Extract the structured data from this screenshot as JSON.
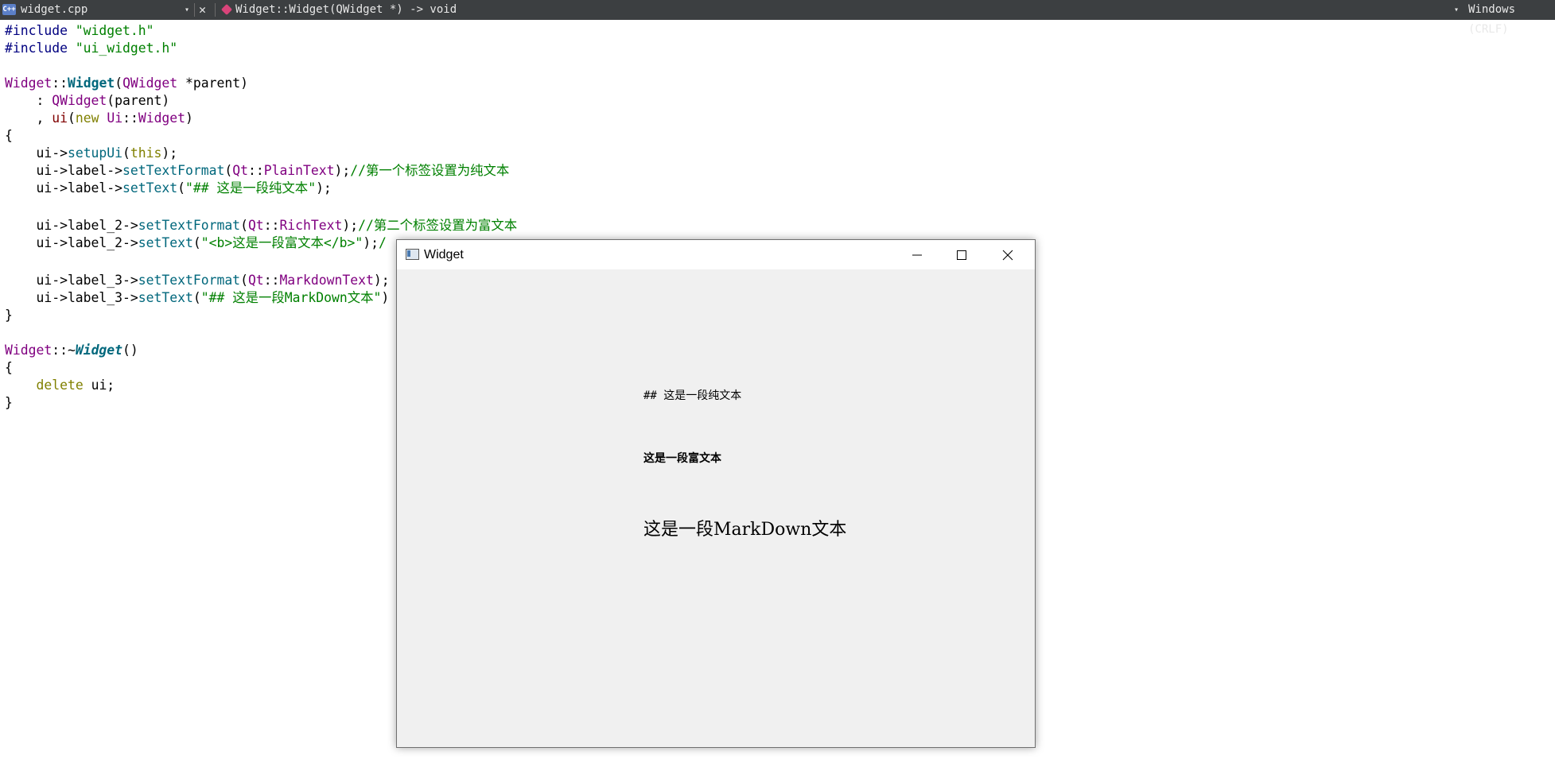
{
  "toolbar": {
    "file_icon": "C++",
    "file_name": "widget.cpp",
    "dropdown_arrow": "▾",
    "close_glyph": "✕",
    "symbol": "Widget::Widget(QWidget *) -> void",
    "encoding": "Windows (CRLF)"
  },
  "code": {
    "l1": {
      "a": "#include ",
      "b": "\"widget.h\""
    },
    "l2": {
      "a": "#include ",
      "b": "\"ui_widget.h\""
    },
    "l4": {
      "a": "Widget",
      "b": "::",
      "c": "Widget",
      "d": "(",
      "e": "QWidget",
      "f": " *parent)"
    },
    "l5": {
      "a": "    : ",
      "b": "QWidget",
      "c": "(parent)"
    },
    "l6": {
      "a": "    , ",
      "b": "ui",
      "c": "(",
      "d": "new",
      "e": " ",
      "f": "Ui",
      "g": "::",
      "h": "Widget",
      "i": ")"
    },
    "l7": {
      "a": "{"
    },
    "l8": {
      "a": "    ui->",
      "b": "setupUi",
      "c": "(",
      "d": "this",
      "e": ");"
    },
    "l9": {
      "a": "    ui->label->",
      "b": "setTextFormat",
      "c": "(",
      "d": "Qt",
      "e": "::",
      "f": "PlainText",
      "g": ");",
      "h": "//第一个标签设置为纯文本"
    },
    "l10": {
      "a": "    ui->label->",
      "b": "setText",
      "c": "(",
      "d": "\"## 这是一段纯文本\"",
      "e": ");"
    },
    "l12": {
      "a": "    ui->label_2->",
      "b": "setTextFormat",
      "c": "(",
      "d": "Qt",
      "e": "::",
      "f": "RichText",
      "g": ");",
      "h": "//第二个标签设置为富文本"
    },
    "l13": {
      "a": "    ui->label_2->",
      "b": "setText",
      "c": "(",
      "d": "\"<b>这是一段富文本</b>\"",
      "e": ");",
      "f": "/"
    },
    "l15": {
      "a": "    ui->label_3->",
      "b": "setTextFormat",
      "c": "(",
      "d": "Qt",
      "e": "::",
      "f": "MarkdownText",
      "g": ");"
    },
    "l16": {
      "a": "    ui->label_3->",
      "b": "setText",
      "c": "(",
      "d": "\"## 这是一段MarkDown文本\"",
      "e": ")"
    },
    "l17": {
      "a": "}"
    },
    "l19": {
      "a": "Widget",
      "b": "::~",
      "c": "Widget",
      "d": "()"
    },
    "l20": {
      "a": "{"
    },
    "l21": {
      "a": "    ",
      "b": "delete",
      "c": " ui;"
    },
    "l22": {
      "a": "}"
    }
  },
  "window": {
    "title": "Widget",
    "label_plain": "## 这是一段纯文本",
    "label_rich": "这是一段富文本",
    "label_markdown": "这是一段MarkDown文本"
  }
}
